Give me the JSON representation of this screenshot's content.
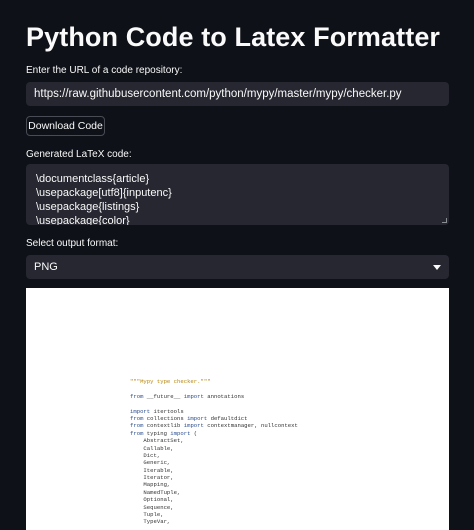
{
  "page": {
    "title": "Python Code to Latex Formatter"
  },
  "url_input": {
    "label": "Enter the URL of a code repository:",
    "value": "https://raw.githubusercontent.com/python/mypy/master/mypy/checker.py"
  },
  "download_button": {
    "label": "Download Code"
  },
  "latex_output": {
    "label": "Generated LaTeX code:",
    "lines": [
      "\\documentclass{article}",
      "\\usepackage[utf8]{inputenc}",
      "\\usepackage{listings}",
      "\\usepackage{color}"
    ]
  },
  "format_select": {
    "label": "Select output format:",
    "selected": "PNG"
  },
  "preview": {
    "lines": [
      {
        "n": "",
        "segments": [
          {
            "t": "\"\"\"Mypy type checker.\"\"\"",
            "c": "str"
          }
        ]
      },
      {
        "n": "",
        "segments": [
          {
            "t": "",
            "c": ""
          }
        ]
      },
      {
        "n": "",
        "segments": [
          {
            "t": "from",
            "c": "kw"
          },
          {
            "t": " __future__ ",
            "c": ""
          },
          {
            "t": "import",
            "c": "kw"
          },
          {
            "t": " annotations",
            "c": ""
          }
        ]
      },
      {
        "n": "",
        "segments": [
          {
            "t": "",
            "c": ""
          }
        ]
      },
      {
        "n": "",
        "segments": [
          {
            "t": "import",
            "c": "kw"
          },
          {
            "t": " itertools",
            "c": ""
          }
        ]
      },
      {
        "n": "",
        "segments": [
          {
            "t": "from",
            "c": "kw"
          },
          {
            "t": " collections ",
            "c": ""
          },
          {
            "t": "import",
            "c": "kw"
          },
          {
            "t": " defaultdict",
            "c": ""
          }
        ]
      },
      {
        "n": "",
        "segments": [
          {
            "t": "from",
            "c": "kw"
          },
          {
            "t": " contextlib ",
            "c": ""
          },
          {
            "t": "import",
            "c": "kw"
          },
          {
            "t": " contextmanager, nullcontext",
            "c": ""
          }
        ]
      },
      {
        "n": "",
        "segments": [
          {
            "t": "from",
            "c": "kw"
          },
          {
            "t": " typing ",
            "c": ""
          },
          {
            "t": "import",
            "c": "kw"
          },
          {
            "t": " (",
            "c": ""
          }
        ]
      },
      {
        "n": "",
        "segments": [
          {
            "t": "    AbstractSet,",
            "c": ""
          }
        ]
      },
      {
        "n": "",
        "segments": [
          {
            "t": "    Callable,",
            "c": ""
          }
        ]
      },
      {
        "n": "",
        "segments": [
          {
            "t": "    Dict,",
            "c": ""
          }
        ]
      },
      {
        "n": "",
        "segments": [
          {
            "t": "    Generic,",
            "c": ""
          }
        ]
      },
      {
        "n": "",
        "segments": [
          {
            "t": "    Iterable,",
            "c": ""
          }
        ]
      },
      {
        "n": "",
        "segments": [
          {
            "t": "    Iterator,",
            "c": ""
          }
        ]
      },
      {
        "n": "",
        "segments": [
          {
            "t": "    Mapping,",
            "c": ""
          }
        ]
      },
      {
        "n": "",
        "segments": [
          {
            "t": "    NamedTuple,",
            "c": ""
          }
        ]
      },
      {
        "n": "",
        "segments": [
          {
            "t": "    Optional,",
            "c": ""
          }
        ]
      },
      {
        "n": "",
        "segments": [
          {
            "t": "    Sequence,",
            "c": ""
          }
        ]
      },
      {
        "n": "",
        "segments": [
          {
            "t": "    Tuple,",
            "c": ""
          }
        ]
      },
      {
        "n": "",
        "segments": [
          {
            "t": "    TypeVar,",
            "c": ""
          }
        ]
      }
    ]
  },
  "colors": {
    "background": "#0e1117",
    "input_bg": "#262730",
    "text": "#fafafa",
    "keyword": "#2a4d8f",
    "string": "#b8860b"
  }
}
